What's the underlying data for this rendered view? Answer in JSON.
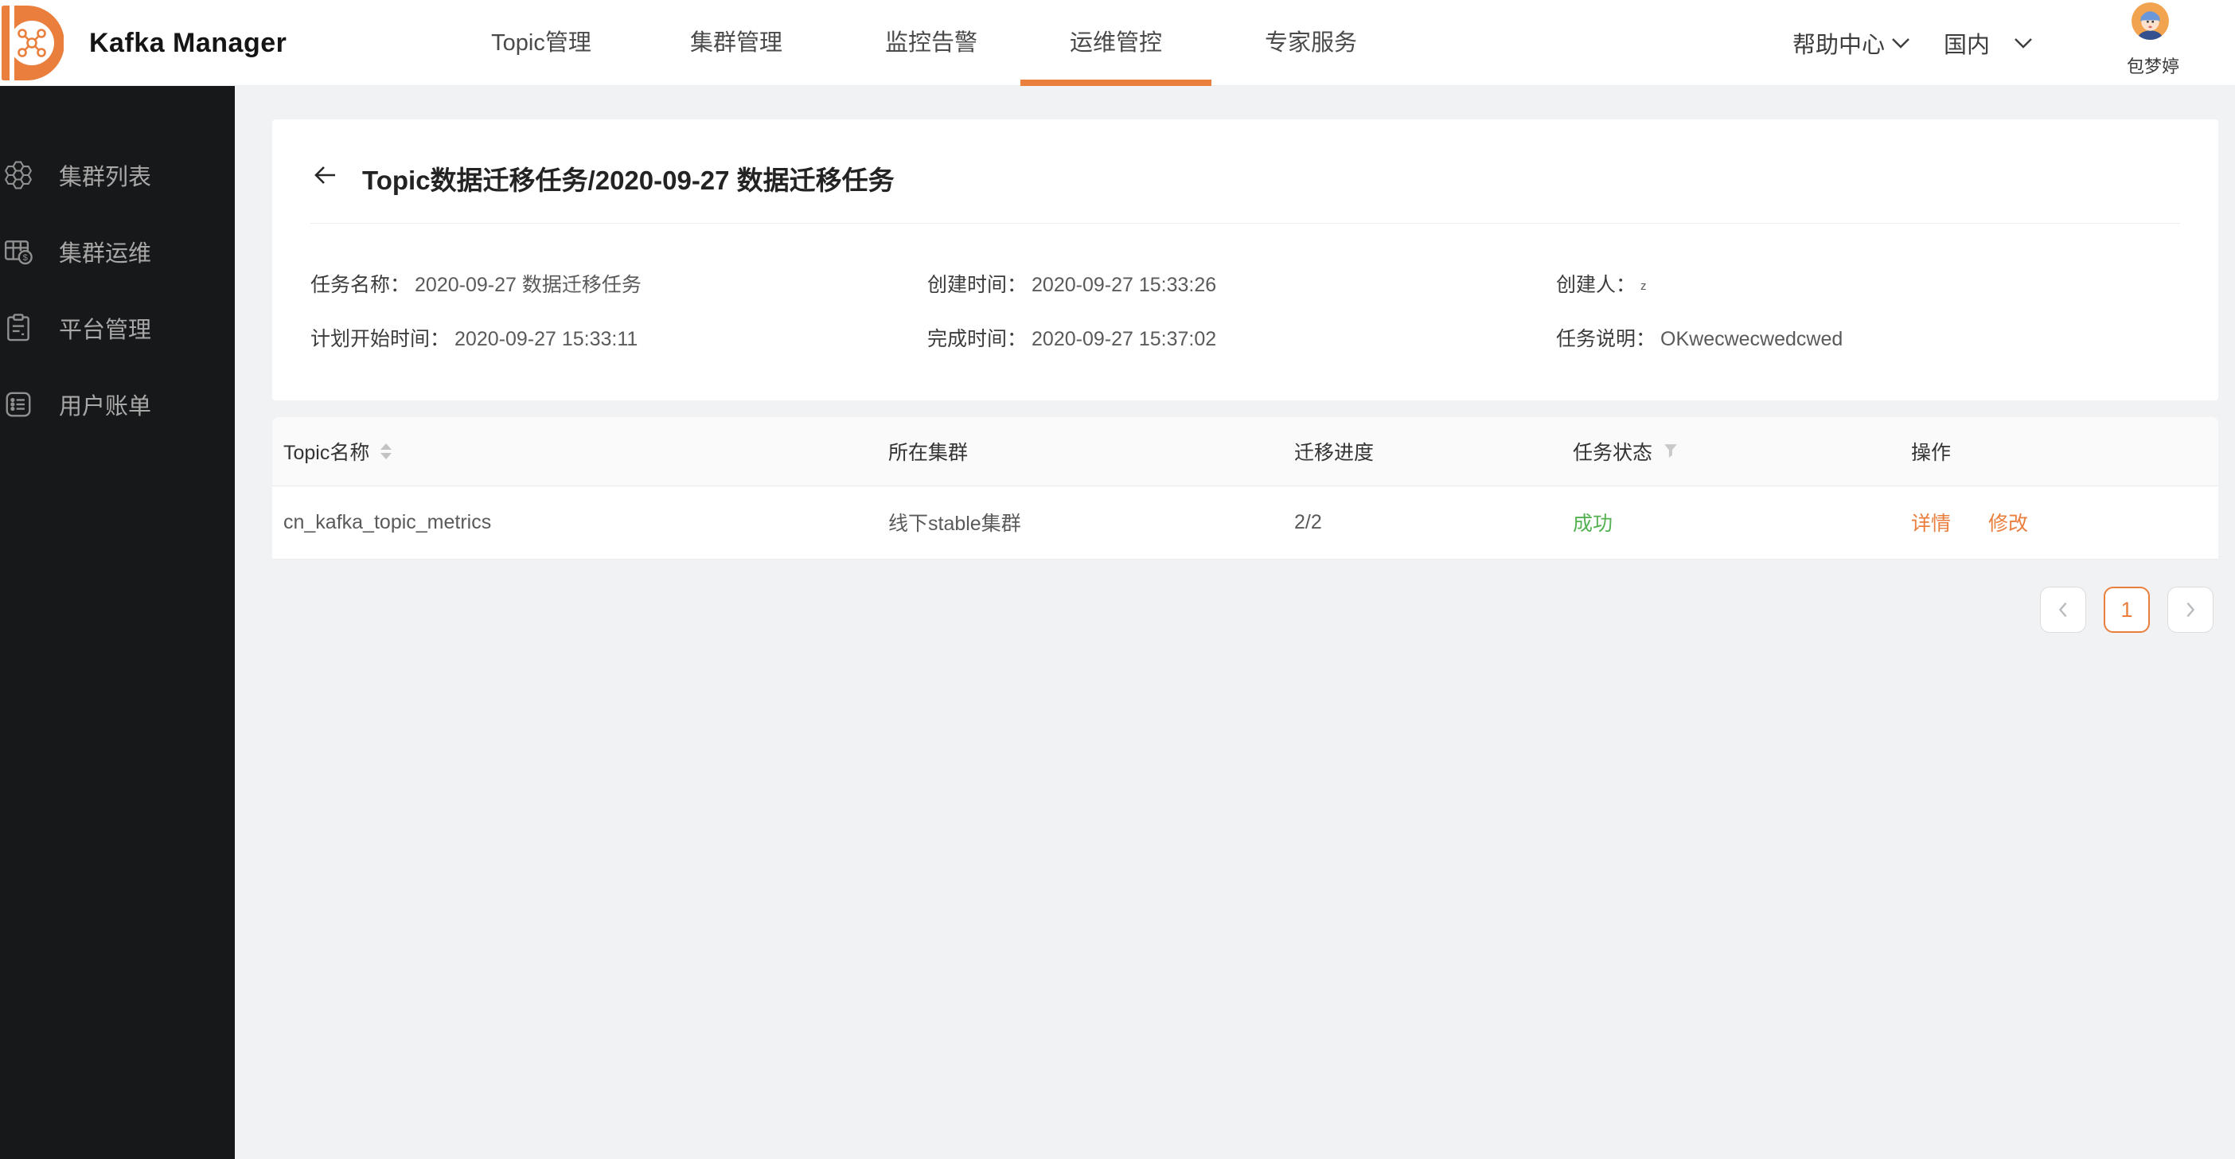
{
  "app": {
    "title": "Kafka Manager"
  },
  "header": {
    "nav": [
      "Topic管理",
      "集群管理",
      "监控告警",
      "运维管控",
      "专家服务"
    ],
    "active_nav": "运维管控",
    "help_center": "帮助中心",
    "region": "国内",
    "username": "包梦婷"
  },
  "sidebar": {
    "items": [
      {
        "label": "集群列表",
        "icon": "cluster-list-icon"
      },
      {
        "label": "集群运维",
        "icon": "cluster-ops-icon"
      },
      {
        "label": "平台管理",
        "icon": "platform-manage-icon"
      },
      {
        "label": "用户账单",
        "icon": "user-billing-icon"
      }
    ]
  },
  "page": {
    "title": "Topic数据迁移任务/2020-09-27 数据迁移任务",
    "details": [
      {
        "label": "任务名称：",
        "value": "2020-09-27 数据迁移任务"
      },
      {
        "label": "创建时间：",
        "value": "2020-09-27 15:33:26"
      },
      {
        "label": "创建人：",
        "value": "z"
      },
      {
        "label": "计划开始时间：",
        "value": "2020-09-27 15:33:11"
      },
      {
        "label": "完成时间：",
        "value": "2020-09-27 15:37:02"
      },
      {
        "label": "任务说明：",
        "value": "OKwecwecwedcwed"
      }
    ]
  },
  "table": {
    "columns": [
      "Topic名称",
      "所在集群",
      "迁移进度",
      "任务状态",
      "操作"
    ],
    "rows": [
      {
        "topic": "cn_kafka_topic_metrics",
        "cluster": "线下stable集群",
        "progress": "2/2",
        "status": "成功",
        "actions": [
          "详情",
          "修改"
        ]
      }
    ]
  },
  "pagination": {
    "current_page": "1"
  },
  "colors": {
    "accent": "#ea7e3c",
    "success": "#53b152",
    "sidebar_bg": "#17181a"
  }
}
